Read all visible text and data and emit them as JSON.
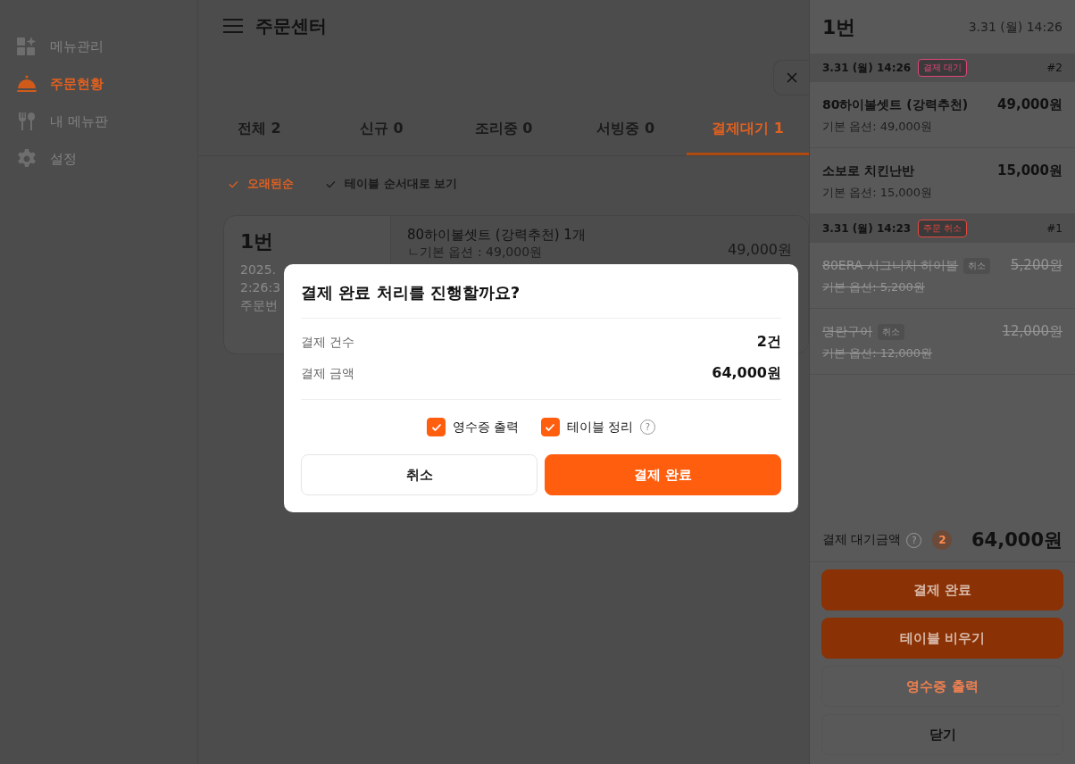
{
  "sidebar": {
    "items": [
      {
        "label": "메뉴관리",
        "selected": false
      },
      {
        "label": "주문현황",
        "selected": true
      },
      {
        "label": "내 메뉴판",
        "selected": false
      },
      {
        "label": "설정",
        "selected": false
      }
    ]
  },
  "header": {
    "title": "주문센터"
  },
  "tabs": [
    {
      "label": "전체 2",
      "selected": false
    },
    {
      "label": "신규 0",
      "selected": false
    },
    {
      "label": "조리중 0",
      "selected": false
    },
    {
      "label": "서빙중 0",
      "selected": false
    },
    {
      "label": "결제대기 1",
      "selected": true
    }
  ],
  "filters": [
    {
      "label": "오래된순",
      "checked": true
    },
    {
      "label": "테이블 순서대로 보기",
      "checked": false
    }
  ],
  "order_card": {
    "table": "1번",
    "lines": [
      "2025.",
      "2:26:3",
      "주문번"
    ],
    "items": [
      {
        "name": "80하이볼셋트 (강력추천) 1개",
        "option": "ㄴ기본 옵션 : 49,000원",
        "price": "49,000원"
      }
    ]
  },
  "panel": {
    "title": "1번",
    "time": "3.31 (월) 14:26",
    "groups": [
      {
        "time": "3.31 (월) 14:26",
        "status": "결제 대기",
        "color": "#e0457b",
        "number": "#2",
        "items": [
          {
            "name": "80하이볼셋트 (강력추천)",
            "option": "기본 옵션: 49,000원",
            "price": "49,000원",
            "cancelled": false
          },
          {
            "name": "소보로 치킨난반",
            "option": "기본 옵션: 15,000원",
            "price": "15,000원",
            "cancelled": false
          }
        ]
      },
      {
        "time": "3.31 (월) 14:23",
        "status": "주문 취소",
        "color": "#e5483f",
        "number": "#1",
        "items": [
          {
            "name": "80ERA 시그니처 하이볼",
            "badge": "취소",
            "option": "기본 옵션: 5,200원",
            "price": "5,200원",
            "cancelled": true
          },
          {
            "name": "명란구이",
            "badge": "취소",
            "option": "기본 옵션: 12,000원",
            "price": "12,000원",
            "cancelled": true
          }
        ]
      }
    ],
    "summary": {
      "label": "결제 대기금액",
      "help": "?",
      "count": "2",
      "amount": "64,000원"
    },
    "buttons": [
      {
        "label": "결제 완료",
        "kind": "primary"
      },
      {
        "label": "테이블 비우기",
        "kind": "primary"
      },
      {
        "label": "영수증 출력",
        "kind": "outline"
      },
      {
        "label": "닫기",
        "kind": "plain"
      }
    ]
  },
  "dialog": {
    "title": "결제 완료 처리를 진행할까요?",
    "rows": [
      {
        "label": "결제 건수",
        "value": "2건"
      },
      {
        "label": "결제 금액",
        "value": "64,000원"
      }
    ],
    "options": [
      {
        "label": "영수증 출력",
        "checked": true
      },
      {
        "label": "테이블 정리",
        "checked": true,
        "help": "?"
      }
    ],
    "buttons": [
      {
        "label": "취소",
        "kind": "plain"
      },
      {
        "label": "결제 완료",
        "kind": "primary"
      }
    ]
  }
}
